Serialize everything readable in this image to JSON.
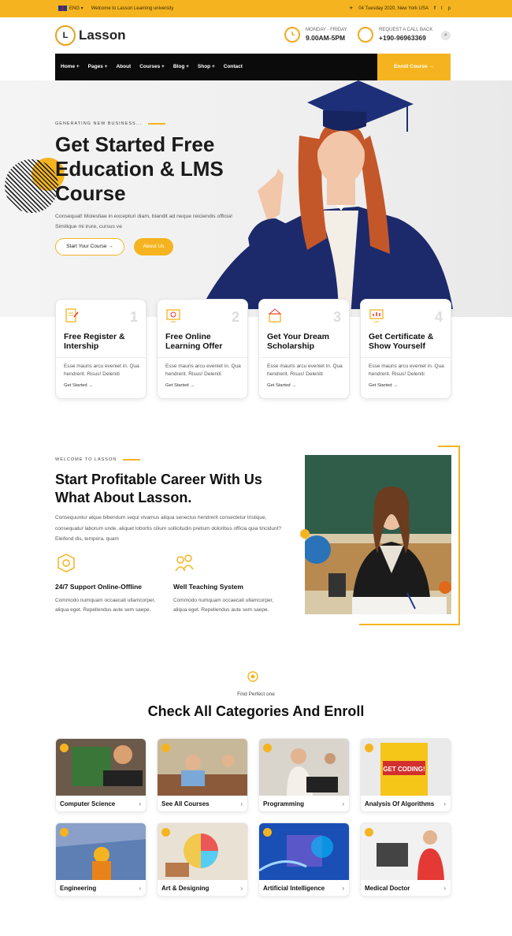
{
  "topbar": {
    "lang": "ENG",
    "welcome": "Welcome to Lasson Learning university",
    "date_location": "04 Tuesday 2020, New York USA",
    "social": [
      "f",
      "t",
      "p"
    ]
  },
  "header": {
    "logo_letter": "L",
    "logo_text": "Lasson",
    "hours_label": "MONDAY - FRIDAY",
    "hours_value": "9.00AM-5PM",
    "callback_label": "REQUEST A CALL BACK",
    "callback_value": "+190-96963369"
  },
  "nav": {
    "items": [
      "Home +",
      "Pages +",
      "About",
      "Courses +",
      "Blog +",
      "Shop +",
      "Contact"
    ],
    "enroll": "Enroll Course →"
  },
  "hero": {
    "eyebrow": "GENERATING NEW BUSINESS...",
    "title_lines": [
      "Get Started Free",
      "Education & LMS",
      "Course"
    ],
    "text": "Consequat! Molestiae in excepturi diam, blandit ad neque reiciendis officia! Similique mi irure, cursus ve",
    "btn_primary": "Start Your Course →",
    "btn_secondary": "About Us"
  },
  "steps": [
    {
      "num": "1",
      "title": "Free Register & Intership",
      "text": "Esse mauris arcu eveniet in. Qua hendrerit. Risus! Deleniti",
      "link": "Get Started →"
    },
    {
      "num": "2",
      "title": "Free Online Learning Offer",
      "text": "Esse mauris arcu eveniet in. Qua hendrerit. Risus! Deleniti",
      "link": "Get Started →"
    },
    {
      "num": "3",
      "title": "Get Your Dream Scholarship",
      "text": "Esse mauris arcu eveniet in. Qua hendrerit. Risus! Deleniti",
      "link": "Get Started →"
    },
    {
      "num": "4",
      "title": "Get Certificate & Show Yourself",
      "text": "Esse mauris arcu eveniet in. Qua hendrerit. Risus! Deleniti",
      "link": "Get Started →"
    }
  ],
  "about": {
    "eyebrow": "WELCOME TO LASSON",
    "title_lines": [
      "Start Profitable Career With Us",
      "What About Lasson."
    ],
    "text": "Consequuntur atque bibendum sequi vivamus aliqua senectus hendrerit consectetur tristique, consequatur laborum unde, aliquet lobortis cilium sollicitudin pretium doloribus officia quia tincidunt? Eleifend dis, tempora, quam",
    "features": [
      {
        "title": "24/7 Support Online-Offline",
        "text": "Commodo numquam occaecati ullamcorper, aliqua eget. Repellendus aute sem saepe."
      },
      {
        "title": "Well Teaching System",
        "text": "Commodo numquam occaecati ullamcorper, aliqua eget. Repellendus aute sem saepe."
      }
    ]
  },
  "categories": {
    "eyebrow": "Find Perfect one",
    "title": "Check All Categories And Enroll",
    "items": [
      {
        "label": "Computer Science"
      },
      {
        "label": "See All Courses"
      },
      {
        "label": "Programming"
      },
      {
        "label": "Analysis Of Algorithms"
      },
      {
        "label": "Engineering"
      },
      {
        "label": "Art & Designing"
      },
      {
        "label": "Artificial Intelligence"
      },
      {
        "label": "Medical Doctor"
      }
    ],
    "arrow": "›",
    "book_text": "GET CODING!"
  },
  "colors": {
    "accent": "#f5b41f",
    "dark": "#0b0b0b"
  }
}
